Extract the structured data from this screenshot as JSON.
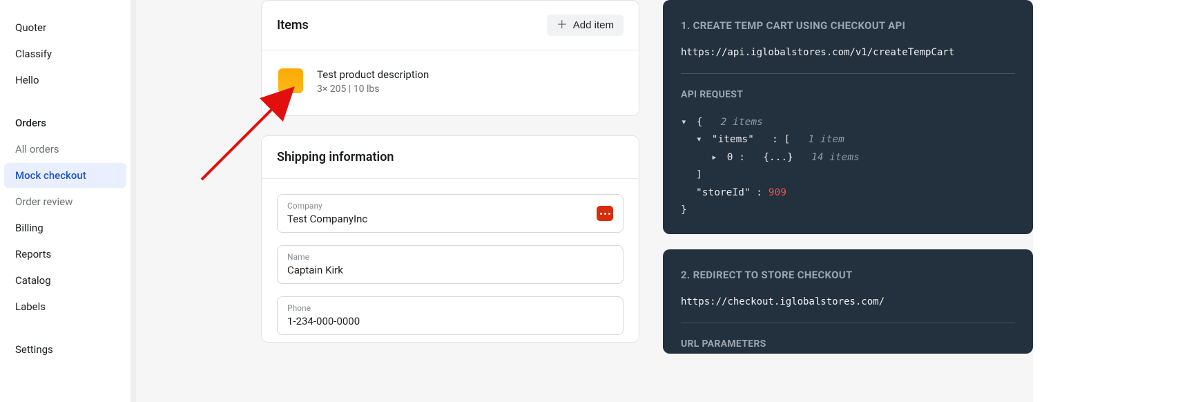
{
  "sidebar": {
    "top": [
      "Quoter",
      "Classify",
      "Hello"
    ],
    "orders_heading": "Orders",
    "orders": [
      "All orders",
      "Mock checkout",
      "Order review"
    ],
    "orders_active_index": 1,
    "rest": [
      "Billing",
      "Reports",
      "Catalog",
      "Labels"
    ],
    "bottom": [
      "Settings"
    ]
  },
  "items_card": {
    "title": "Items",
    "add_button": "Add item",
    "product_title": "Test product description",
    "product_meta": "3× 205 | 10 lbs"
  },
  "shipping": {
    "title": "Shipping information",
    "fields": {
      "company_label": "Company",
      "company_value": "Test CompanyInc",
      "name_label": "Name",
      "name_value": "Captain Kirk",
      "phone_label": "Phone",
      "phone_value": "1-234-000-0000"
    }
  },
  "api": {
    "panel1_title": "1. CREATE TEMP CART USING CHECKOUT API",
    "panel1_url": "https://api.iglobalstores.com/v1/createTempCart",
    "panel1_subhead": "API REQUEST",
    "tree": {
      "root_open": "{",
      "root_count": "2 items",
      "items_key": "\"items\"",
      "items_open": ": [",
      "items_count": "1 item",
      "idx0_key": "0 :",
      "idx0_body": "{...}",
      "idx0_count": "14 items",
      "items_close": "]",
      "store_key": "\"storeId\"",
      "store_colon": " : ",
      "store_val": "909",
      "root_close": "}"
    },
    "panel2_title": "2. REDIRECT TO STORE CHECKOUT",
    "panel2_url": "https://checkout.iglobalstores.com/",
    "panel2_subhead": "URL PARAMETERS"
  }
}
